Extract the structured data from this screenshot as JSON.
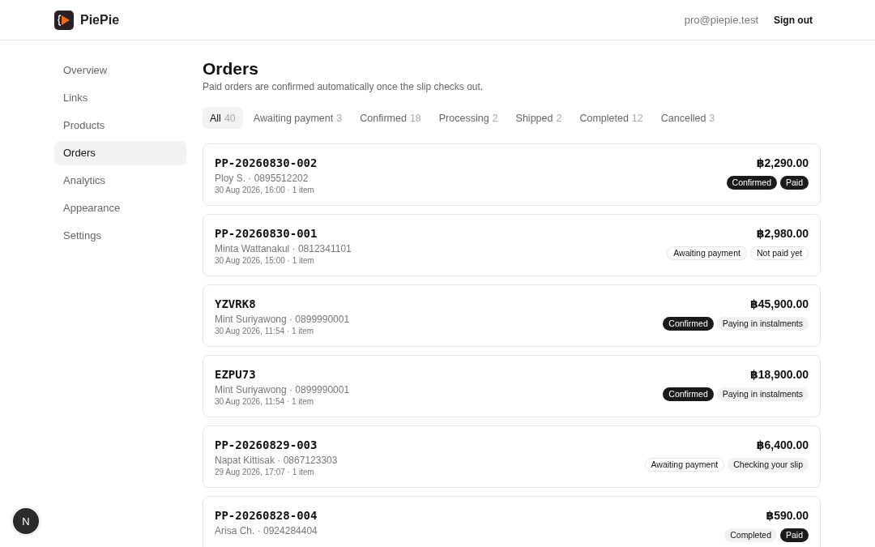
{
  "header": {
    "brand": "PiePie",
    "email": "pro@piepie.test",
    "sign_out": "Sign out"
  },
  "sidebar": {
    "items": [
      {
        "label": "Overview",
        "selected": false
      },
      {
        "label": "Links",
        "selected": false
      },
      {
        "label": "Products",
        "selected": false
      },
      {
        "label": "Orders",
        "selected": true
      },
      {
        "label": "Analytics",
        "selected": false
      },
      {
        "label": "Appearance",
        "selected": false
      },
      {
        "label": "Settings",
        "selected": false
      }
    ]
  },
  "page": {
    "title": "Orders",
    "subtitle": "Paid orders are confirmed automatically once the slip checks out."
  },
  "tabs": [
    {
      "label": "All",
      "count": "40",
      "selected": true
    },
    {
      "label": "Awaiting payment",
      "count": "3",
      "selected": false
    },
    {
      "label": "Confirmed",
      "count": "18",
      "selected": false
    },
    {
      "label": "Processing",
      "count": "2",
      "selected": false
    },
    {
      "label": "Shipped",
      "count": "2",
      "selected": false
    },
    {
      "label": "Completed",
      "count": "12",
      "selected": false
    },
    {
      "label": "Cancelled",
      "count": "3",
      "selected": false
    }
  ],
  "orders": [
    {
      "id": "PP-20260830-002",
      "customer": "Ploy S. · 0895512202",
      "meta": "30 Aug 2026, 16:00 · 1 item",
      "total": "฿2,290.00",
      "badges": [
        {
          "label": "Confirmed",
          "kind": "solid"
        },
        {
          "label": "Paid",
          "kind": "solid"
        }
      ]
    },
    {
      "id": "PP-20260830-001",
      "customer": "Minta Wattanakul · 0812341101",
      "meta": "30 Aug 2026, 15:00 · 1 item",
      "total": "฿2,980.00",
      "badges": [
        {
          "label": "Awaiting payment",
          "kind": "outline"
        },
        {
          "label": "Not paid yet",
          "kind": "outline"
        }
      ]
    },
    {
      "id": "YZVRK8",
      "customer": "Mint Suriyawong · 0899990001",
      "meta": "30 Aug 2026, 11:54 · 1 item",
      "total": "฿45,900.00",
      "badges": [
        {
          "label": "Confirmed",
          "kind": "solid"
        },
        {
          "label": "Paying in instalments",
          "kind": "soft"
        }
      ]
    },
    {
      "id": "EZPU73",
      "customer": "Mint Suriyawong · 0899990001",
      "meta": "30 Aug 2026, 11:54 · 1 item",
      "total": "฿18,900.00",
      "badges": [
        {
          "label": "Confirmed",
          "kind": "solid"
        },
        {
          "label": "Paying in instalments",
          "kind": "soft"
        }
      ]
    },
    {
      "id": "PP-20260829-003",
      "customer": "Napat Kittisak · 0867123303",
      "meta": "29 Aug 2026, 17:07 · 1 item",
      "total": "฿6,400.00",
      "badges": [
        {
          "label": "Awaiting payment",
          "kind": "outline"
        },
        {
          "label": "Checking your slip",
          "kind": "soft"
        }
      ]
    },
    {
      "id": "PP-20260828-004",
      "customer": "Arisa Ch. · 0924284404",
      "total": "฿590.00",
      "badges": [
        {
          "label": "Completed",
          "kind": "soft"
        },
        {
          "label": "Paid",
          "kind": "solid"
        }
      ]
    }
  ],
  "dev_badge": {
    "label": "N"
  }
}
